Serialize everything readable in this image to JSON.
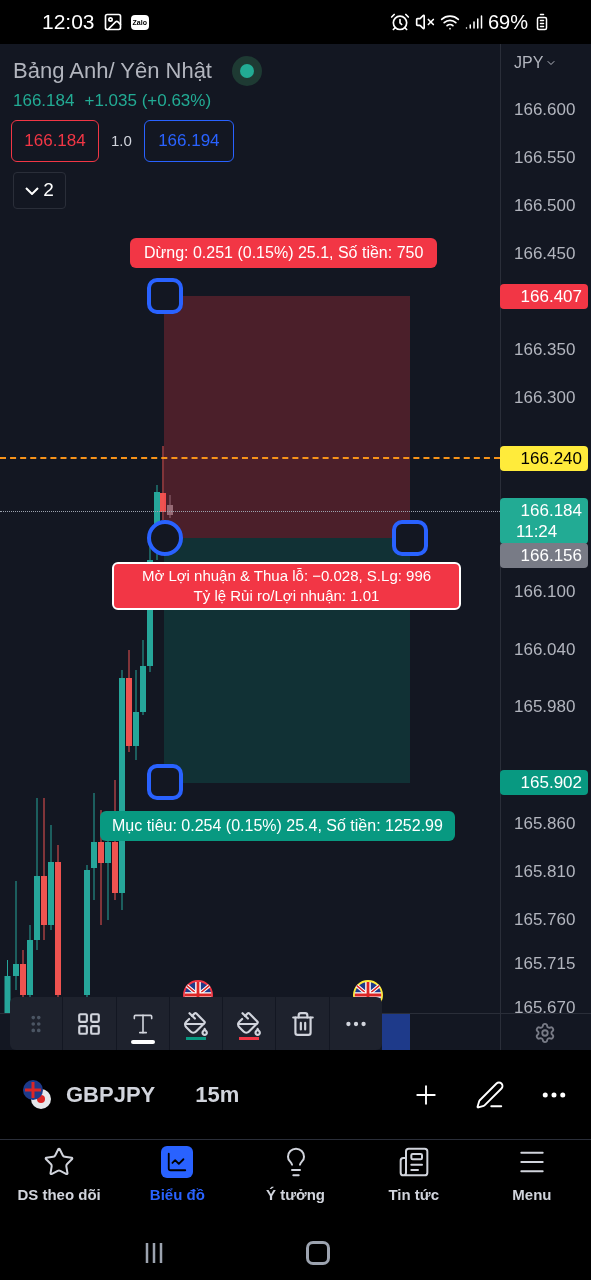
{
  "status_bar": {
    "time": "12:03",
    "app_badge": "Zalo",
    "battery": "69%"
  },
  "symbol": {
    "name": "Bảng Anh/ Yên Nhật",
    "live": true,
    "price": "166.184",
    "change": "+1.035 (+0.63%)"
  },
  "quote": {
    "bid": "166.184",
    "spread": "1.0",
    "ask": "166.194"
  },
  "indicators_toggle": {
    "count": "2",
    "expanded": false
  },
  "price_axis": {
    "currency": "JPY",
    "ticks": [
      "166.600",
      "166.550",
      "166.500",
      "166.450",
      "166.350",
      "166.300",
      "166.100",
      "166.040",
      "165.980",
      "165.860",
      "165.810",
      "165.760",
      "165.715",
      "165.670"
    ]
  },
  "price_markers": [
    {
      "value": "166.407",
      "color": "#f23645"
    },
    {
      "value": "166.240",
      "color": "#ffeb3b"
    },
    {
      "value": "166.184",
      "countdown": "11:24",
      "color": "#22ab94"
    },
    {
      "value": "166.156",
      "color": "#787b86"
    },
    {
      "value": "165.902",
      "color": "#089981"
    }
  ],
  "position": {
    "stop_label": "Dừng: 0.251 (0.15%) 25.1, Số tiền: 750",
    "info_lines": [
      "Mở Lợi nhuận & Thua lỗ: −0.028, S.Lg: 996",
      "Tỷ lệ Rủi ro/Lợi nhuận: 1.01"
    ],
    "target_label": "Mục tiêu: 0.254 (0.15%) 25.4, Số tiền: 1252.99"
  },
  "drawing_toolbar": [
    {
      "kind": "drag",
      "selected": false
    },
    {
      "kind": "objects",
      "selected": false
    },
    {
      "kind": "text",
      "selected": true
    },
    {
      "kind": "fill",
      "selected": false,
      "color": "#089981"
    },
    {
      "kind": "fill",
      "selected": false,
      "color": "#f23645"
    },
    {
      "kind": "delete",
      "selected": false
    },
    {
      "kind": "more",
      "selected": false
    }
  ],
  "symbol_bar": {
    "ticker": "GBPJPY",
    "interval": "15m"
  },
  "bottom_nav": [
    {
      "kind": "watchlist",
      "label": "DS theo dõi",
      "selected": false
    },
    {
      "kind": "chart",
      "label": "Biểu đồ",
      "selected": true
    },
    {
      "kind": "ideas",
      "label": "Ý tưởng",
      "selected": false
    },
    {
      "kind": "news",
      "label": "Tin tức",
      "selected": false
    },
    {
      "kind": "menu",
      "label": "Menu",
      "selected": false
    }
  ]
}
